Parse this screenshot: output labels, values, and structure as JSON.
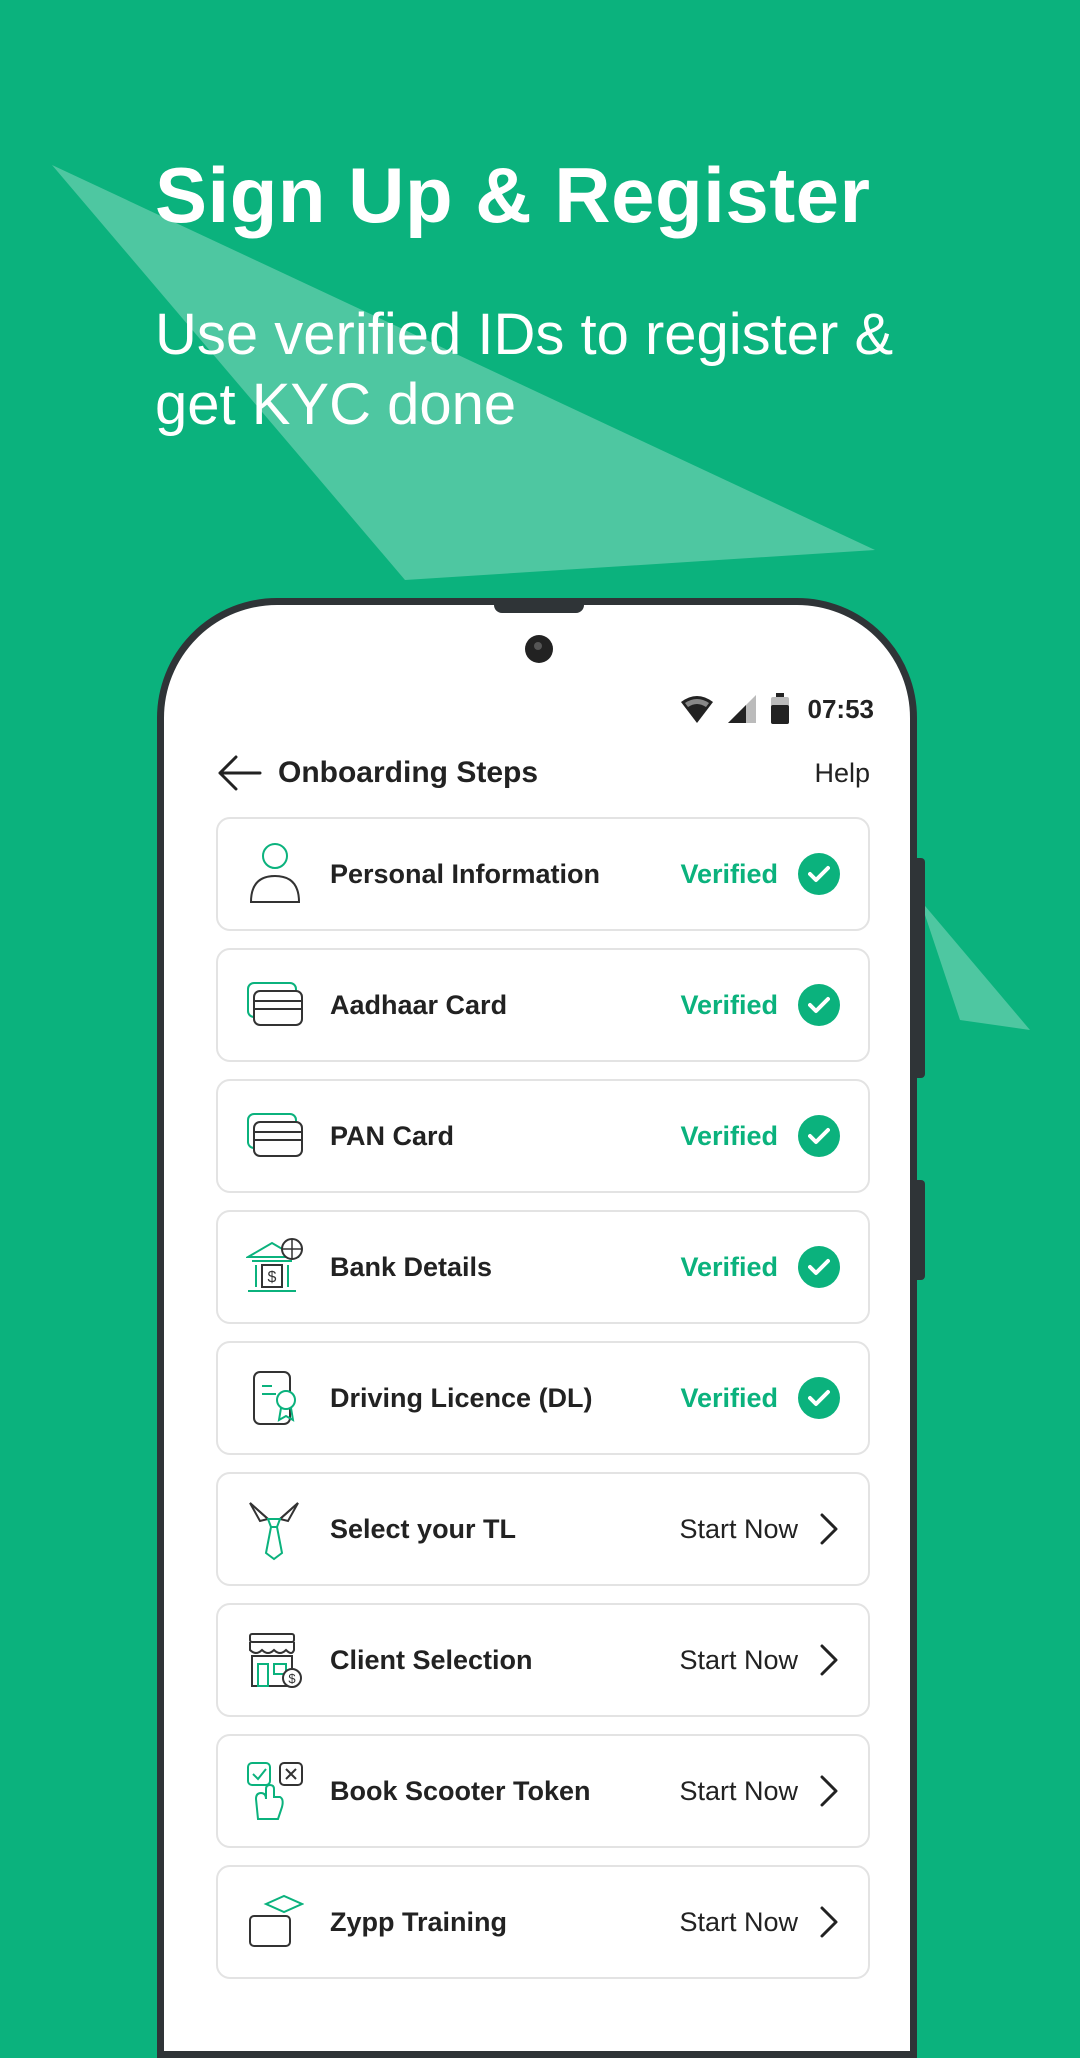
{
  "headline": "Sign Up & Register",
  "subheadline": "Use verified IDs to register & get KYC done",
  "status_bar": {
    "time": "07:53",
    "icons": [
      "wifi-icon",
      "signal-icon",
      "battery-icon"
    ]
  },
  "header": {
    "title": "Onboarding Steps",
    "help_label": "Help",
    "back_icon": "arrow-left-icon"
  },
  "steps": [
    {
      "label": "Personal Information",
      "status": "Verified",
      "icon": "person-icon"
    },
    {
      "label": "Aadhaar Card",
      "status": "Verified",
      "icon": "id-card-icon"
    },
    {
      "label": "PAN Card",
      "status": "Verified",
      "icon": "id-card-icon"
    },
    {
      "label": "Bank Details",
      "status": "Verified",
      "icon": "bank-icon"
    },
    {
      "label": "Driving Licence (DL)",
      "status": "Verified",
      "icon": "licence-icon"
    },
    {
      "label": "Select your TL",
      "status": "Start Now",
      "icon": "tie-icon"
    },
    {
      "label": "Client Selection",
      "status": "Start Now",
      "icon": "store-icon"
    },
    {
      "label": "Book Scooter Token",
      "status": "Start Now",
      "icon": "hand-select-icon"
    },
    {
      "label": "Zypp Training",
      "status": "Start Now",
      "icon": "training-icon"
    }
  ],
  "colors": {
    "brand_green": "#0bb27d",
    "text_dark": "#222222",
    "card_border": "#e3e3e3"
  }
}
